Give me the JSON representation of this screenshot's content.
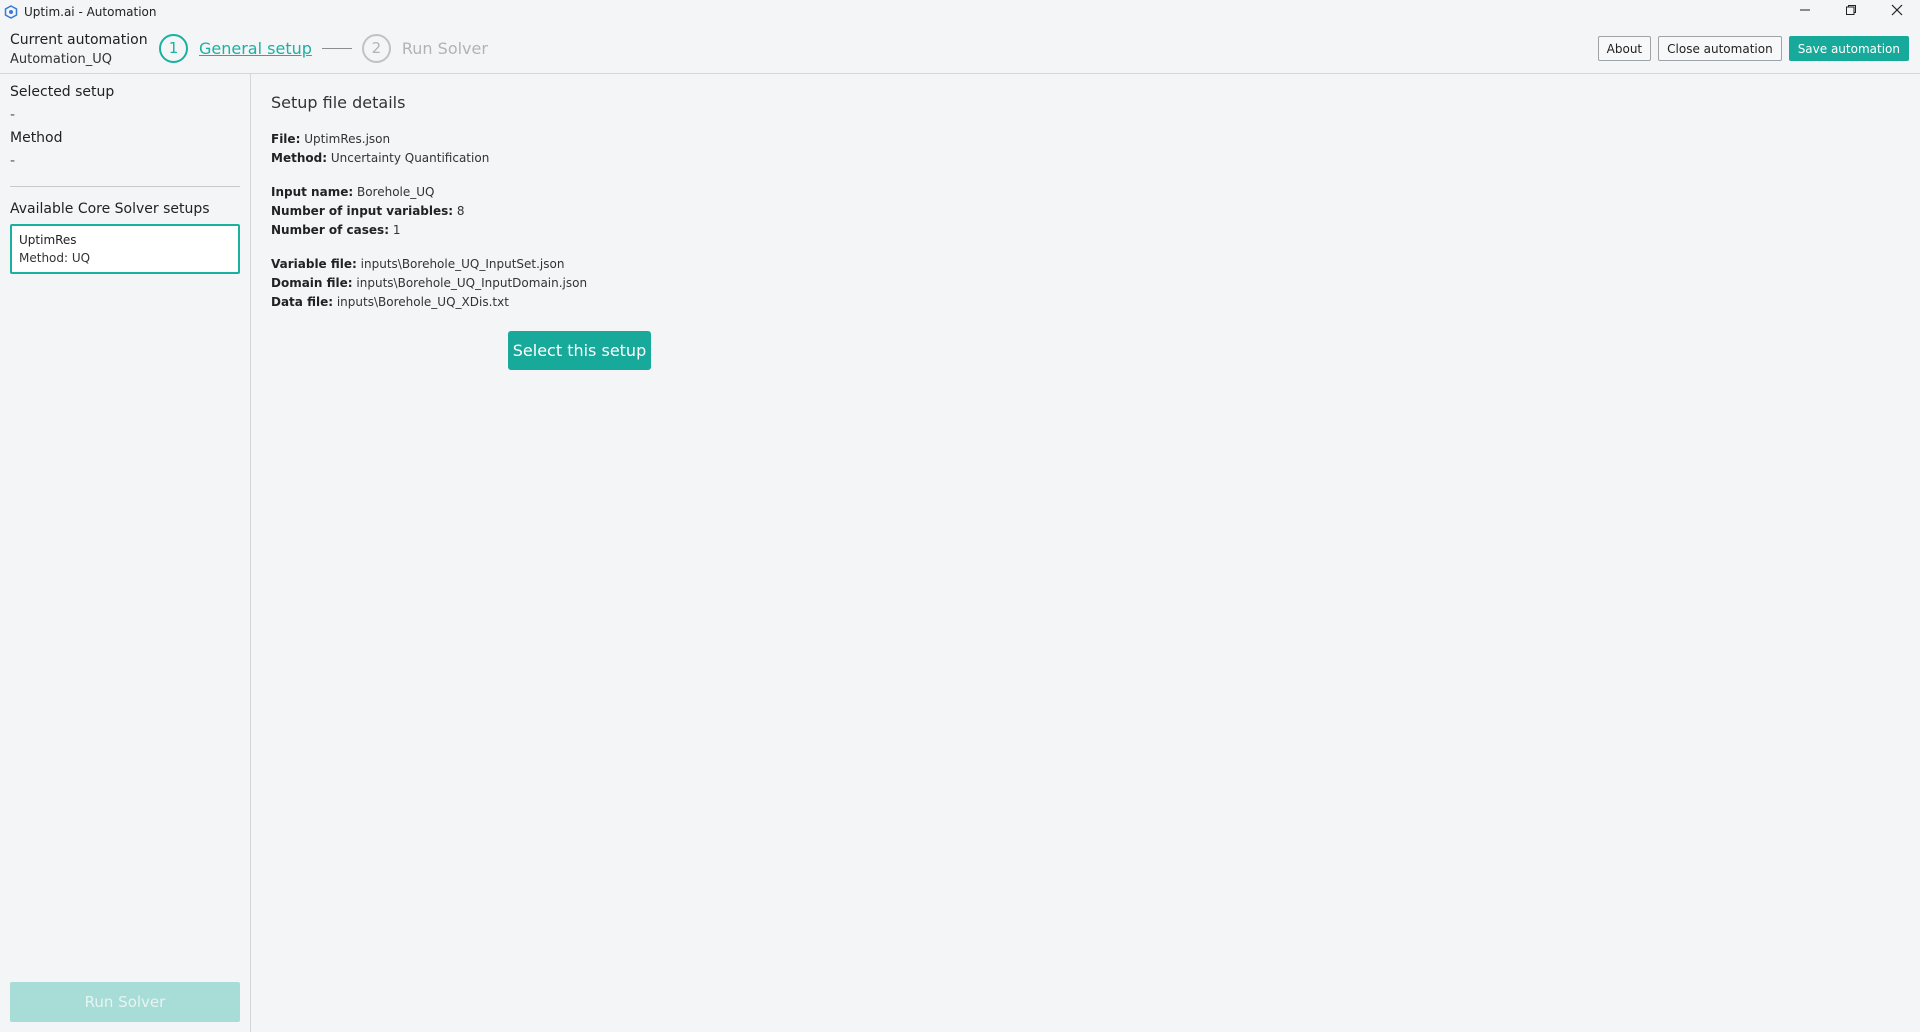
{
  "window": {
    "title": "Uptim.ai - Automation",
    "controls": {
      "minimize": "—",
      "maximize": "❐",
      "close": "✕"
    }
  },
  "header": {
    "current_automation_label": "Current automation",
    "current_automation_value": "Automation_UQ",
    "steps": [
      {
        "number": "1",
        "label": "General setup",
        "state": "active"
      },
      {
        "number": "2",
        "label": "Run Solver",
        "state": "inactive"
      }
    ],
    "buttons": {
      "about": "About",
      "close_automation": "Close automation",
      "save_automation": "Save automation"
    }
  },
  "sidebar": {
    "selected_setup_label": "Selected setup",
    "selected_setup_value": "-",
    "method_label": "Method",
    "method_value": "-",
    "available_label": "Available Core Solver setups",
    "setups": [
      {
        "name": "UptimRes",
        "method": "Method: UQ"
      }
    ],
    "run_solver_label": "Run Solver"
  },
  "main": {
    "title": "Setup file details",
    "details": {
      "file_label": "File:",
      "file_value": "UptimRes.json",
      "method_label": "Method:",
      "method_value": "Uncertainty Quantification",
      "input_name_label": "Input name:",
      "input_name_value": "Borehole_UQ",
      "num_vars_label": "Number of input variables:",
      "num_vars_value": "8",
      "num_cases_label": "Number of cases:",
      "num_cases_value": "1",
      "variable_file_label": "Variable file:",
      "variable_file_value": "inputs\\Borehole_UQ_InputSet.json",
      "domain_file_label": "Domain file:",
      "domain_file_value": "inputs\\Borehole_UQ_InputDomain.json",
      "data_file_label": "Data file:",
      "data_file_value": "inputs\\Borehole_UQ_XDis.txt"
    },
    "select_button": "Select this setup"
  },
  "colors": {
    "accent": "#17a99a",
    "accent_disabled": "#a8dcd6",
    "background": "#f3f5f7"
  }
}
